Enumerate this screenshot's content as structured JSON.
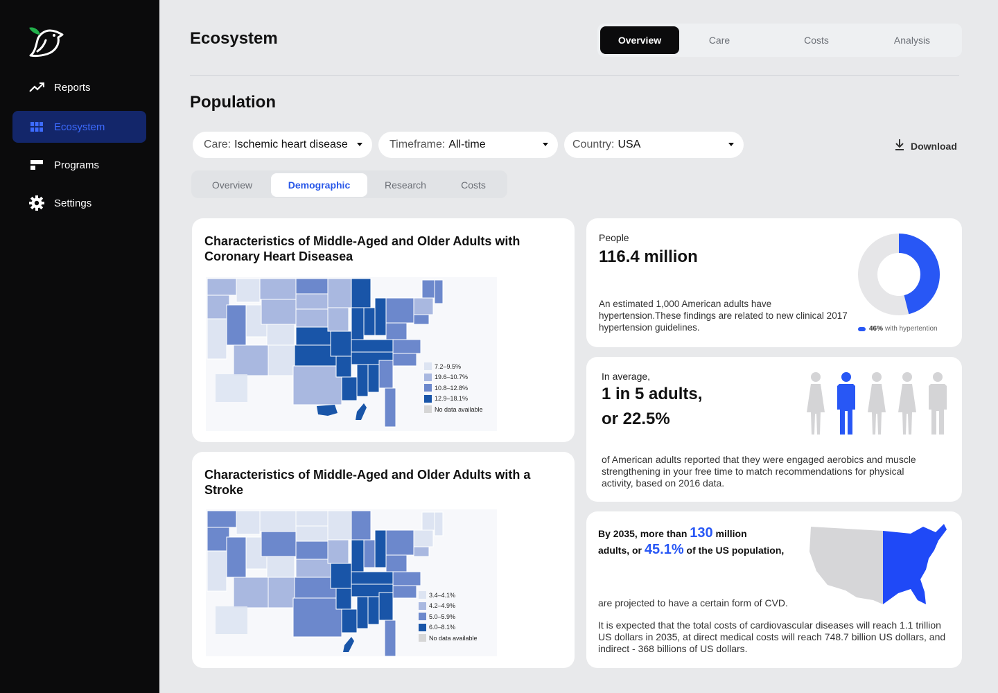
{
  "sidebar": {
    "items": [
      {
        "label": "Reports",
        "icon": "trend-up-icon"
      },
      {
        "label": "Ecosystem",
        "icon": "grid-icon",
        "active": true
      },
      {
        "label": "Programs",
        "icon": "layout-icon"
      },
      {
        "label": "Settings",
        "icon": "gear-icon"
      }
    ]
  },
  "header": {
    "title": "Ecosystem",
    "tabs": [
      "Overview",
      "Care",
      "Costs",
      "Analysis"
    ],
    "active_tab": "Overview"
  },
  "section": {
    "title": "Population"
  },
  "filters": [
    {
      "key": "Care:",
      "value": "Ischemic heart disease"
    },
    {
      "key": "Timeframe:",
      "value": "All-time"
    },
    {
      "key": "Country:",
      "value": "USA"
    }
  ],
  "download_label": "Download",
  "sub_tabs": [
    "Overview",
    "Demographic",
    "Research",
    "Costs"
  ],
  "active_sub_tab": "Demographic",
  "chd_card": {
    "title": "Characteristics of Middle-Aged and Older Adults with Coronary Heart Diseasea",
    "legend": [
      "7.2–9.5%",
      "19.6–10.7%",
      "10.8–12.8%",
      "12.9–18.1%",
      "No data available"
    ]
  },
  "stroke_card": {
    "title": "Characteristics of Middle-Aged and Older Adults with a Stroke",
    "legend": [
      "3.4–4.1%",
      "4.2–4.9%",
      "5.0–5.9%",
      "6.0–8.1%",
      "No data available"
    ]
  },
  "people_card": {
    "label": "People",
    "value": "116.4  million",
    "description": "An estimated 1,000 American adults have hypertension.These findings are related to new clinical 2017 hypertension guidelines.",
    "donut_percent": 46,
    "donut_legend_value": "46%",
    "donut_legend_text": "with hypertention"
  },
  "average_card": {
    "label": "In average,",
    "line1": "1 in 5 adults,",
    "line2": "or 22.5%",
    "description": "of American adults reported that they were engaged aerobics and muscle strengthening in your free time to match recommendations for physical activity, based on 2016 data.",
    "highlighted_figure": 2,
    "figures_total": 5
  },
  "projection_card": {
    "pre1": "By 2035, more than",
    "hl1": "130",
    "post1": "million",
    "pre2": "adults, or",
    "hl2": "45.1%",
    "post2": "of the US population,",
    "mid": "are projected to have a certain form of CVD.",
    "description": "It is expected that the total costs of cardiovascular diseases will reach 1.1 trillion US dollars in 2035, at direct medical costs will reach 748.7 billion US dollars, and indirect - 368 billions of US dollars."
  },
  "colors": {
    "accent": "#2857f5",
    "map_shades": [
      "#dde4f2",
      "#a9b8e0",
      "#6c88cc",
      "#1955a8"
    ],
    "no_data": "#d6d6d6"
  }
}
